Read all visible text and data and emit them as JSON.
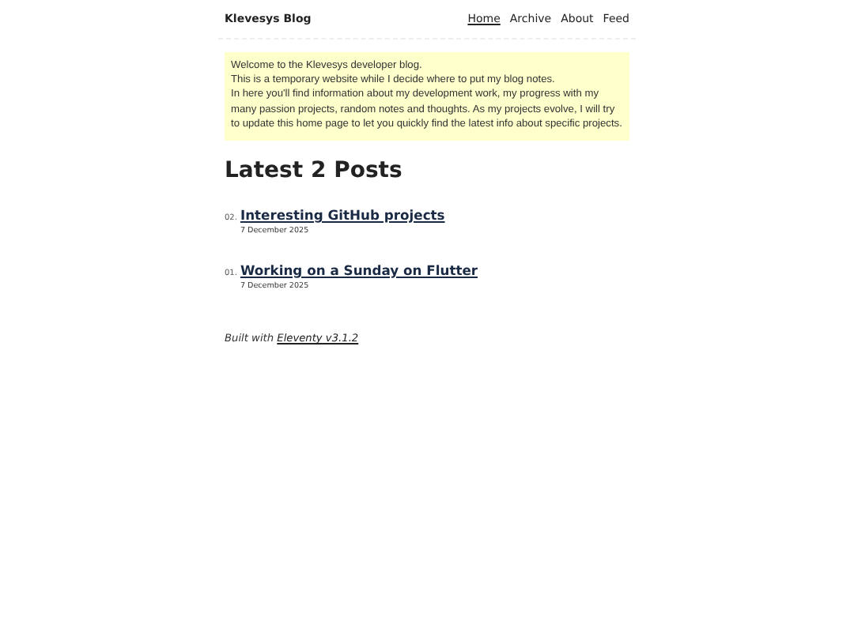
{
  "header": {
    "site_title": "Klevesys Blog",
    "nav": [
      {
        "label": "Home",
        "selected": true
      },
      {
        "label": "Archive",
        "selected": false
      },
      {
        "label": "About",
        "selected": false
      },
      {
        "label": "Feed",
        "selected": false
      }
    ]
  },
  "intro": [
    "Welcome to the Klevesys developer blog.",
    "This is a temporary website while I decide where to put my blog notes.",
    "In here you'll find information about my development work, my progress with my many passion projects, random notes and thoughts. As my projects evolve, I will try to update this home page to let you quickly find the latest info about specific projects."
  ],
  "heading": "Latest 2 Posts",
  "posts": [
    {
      "number": "02.",
      "title": "Interesting GitHub projects",
      "date": "7 December 2025"
    },
    {
      "number": "01.",
      "title": "Working on a Sunday on Flutter",
      "date": "7 December 2025"
    }
  ],
  "footer": {
    "text": "Built with",
    "link": "Eleventy v3.1.2"
  }
}
